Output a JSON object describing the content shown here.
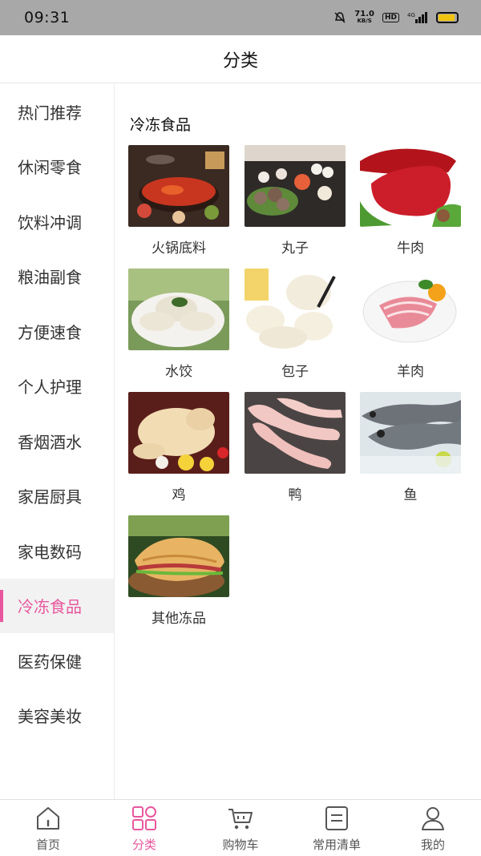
{
  "status_bar": {
    "time": "09:31",
    "net_speed_value": "71.0",
    "net_speed_unit": "KB/S",
    "hd_label": "HD",
    "signal_label": "4G"
  },
  "header": {
    "title": "分类"
  },
  "sidebar": {
    "items": [
      {
        "label": "热门推荐"
      },
      {
        "label": "休闲零食"
      },
      {
        "label": "饮料冲调"
      },
      {
        "label": "粮油副食"
      },
      {
        "label": "方便速食"
      },
      {
        "label": "个人护理"
      },
      {
        "label": "香烟酒水"
      },
      {
        "label": "家居厨具"
      },
      {
        "label": "家电数码"
      },
      {
        "label": "冷冻食品"
      },
      {
        "label": "医药保健"
      },
      {
        "label": "美容美妆"
      }
    ],
    "active_index": 9
  },
  "content": {
    "section_title": "冷冻食品",
    "products": [
      {
        "label": "火锅底料",
        "icon": "hotpot-image"
      },
      {
        "label": "丸子",
        "icon": "meatballs-image"
      },
      {
        "label": "牛肉",
        "icon": "beef-image"
      },
      {
        "label": "水饺",
        "icon": "dumplings-image"
      },
      {
        "label": "包子",
        "icon": "buns-image"
      },
      {
        "label": "羊肉",
        "icon": "mutton-image"
      },
      {
        "label": "鸡",
        "icon": "chicken-image"
      },
      {
        "label": "鸭",
        "icon": "duck-feet-image"
      },
      {
        "label": "鱼",
        "icon": "fish-image"
      },
      {
        "label": "其他冻品",
        "icon": "pancake-image"
      }
    ]
  },
  "tabbar": {
    "tabs": [
      {
        "label": "首页",
        "icon": "home-icon"
      },
      {
        "label": "分类",
        "icon": "category-icon"
      },
      {
        "label": "购物车",
        "icon": "cart-icon"
      },
      {
        "label": "常用清单",
        "icon": "list-icon"
      },
      {
        "label": "我的",
        "icon": "user-icon"
      }
    ],
    "active_index": 1
  },
  "colors": {
    "accent": "#e8579e",
    "statusbar": "#a8a8a8"
  }
}
